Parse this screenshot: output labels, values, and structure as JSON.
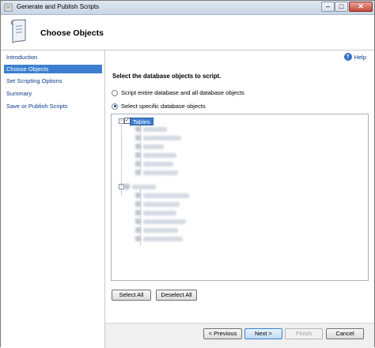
{
  "window": {
    "title": "Generate and Publish Scripts",
    "controls": {
      "minimize": "–",
      "maximize": "□",
      "close": "✕"
    }
  },
  "header": {
    "title": "Choose Objects",
    "icon": "scroll-icon"
  },
  "sidebar": {
    "items": [
      {
        "label": "Introduction",
        "active": false
      },
      {
        "label": "Choose Objects",
        "active": true
      },
      {
        "label": "Set Scripting Options",
        "active": false
      },
      {
        "label": "Summary",
        "active": false
      },
      {
        "label": "Save or Publish Scripts",
        "active": false
      }
    ]
  },
  "content": {
    "help_label": "Help",
    "help_icon": "?",
    "heading": "Select the database objects to script.",
    "options": [
      {
        "label": "Script entire database and all database objects",
        "selected": false
      },
      {
        "label": "Select specific database objects",
        "selected": true
      }
    ],
    "tree": {
      "root_label": "Tables",
      "root_checked": true,
      "expander_expanded": "−",
      "check_glyph": "✓"
    }
  },
  "buttons": {
    "select_all": "Select All",
    "deselect_all": "Deselect All",
    "previous": "< Previous",
    "next": "Next >",
    "finish": "Finish",
    "cancel": "Cancel"
  },
  "colors": {
    "accent": "#3c7fd0",
    "link": "#0a3a8c"
  }
}
